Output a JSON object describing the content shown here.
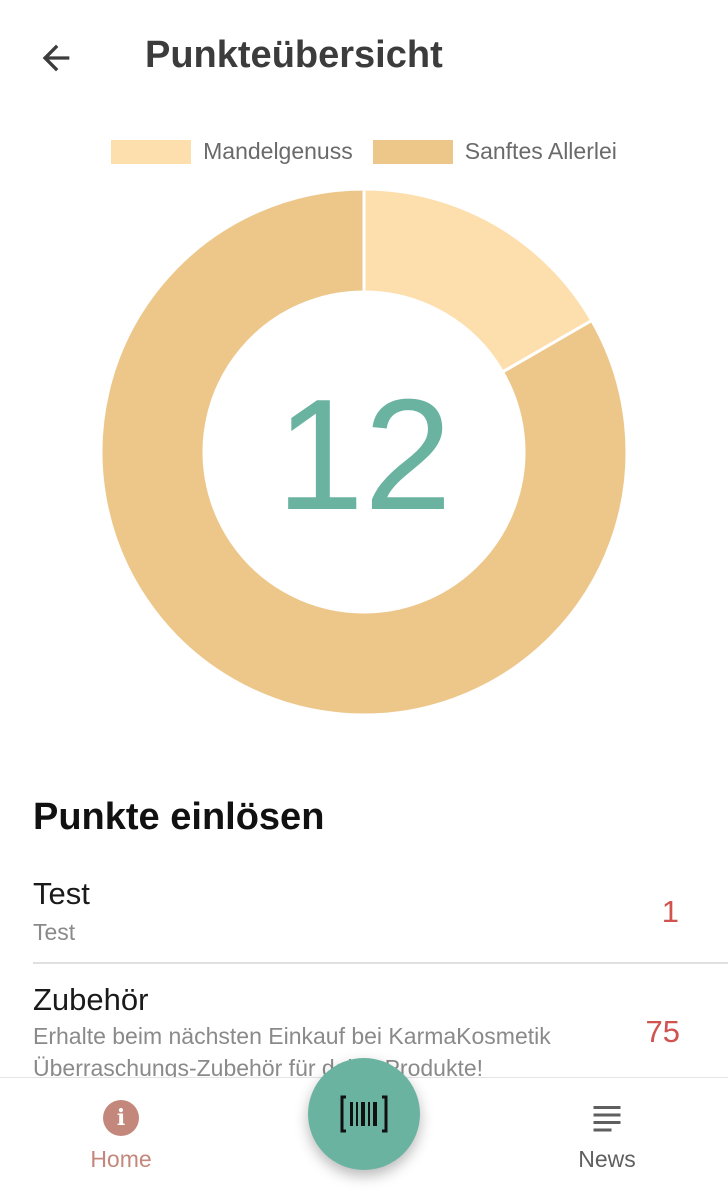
{
  "header": {
    "title": "Punkteübersicht",
    "back_icon": "arrow-left-icon"
  },
  "colors": {
    "accent": "#6bb3a1",
    "home_active": "#c4877c",
    "points_red": "#d0534f",
    "slice_light": "#fddfae",
    "slice_dark": "#edc78a"
  },
  "chart_data": {
    "type": "pie",
    "donut": true,
    "center_text": "12",
    "legend_position": "top",
    "series": [
      {
        "name": "Mandelgenuss",
        "value": 2,
        "color": "#fddfae"
      },
      {
        "name": "Sanftes Allerlei",
        "value": 10,
        "color": "#edc78a"
      }
    ]
  },
  "rewards": {
    "section_title": "Punkte einlösen",
    "items": [
      {
        "title": "Test",
        "description": "Test",
        "points": "1"
      },
      {
        "title": "Zubehör",
        "description": "Erhalte beim nächsten Einkauf bei KarmaKosmetik Überraschungs-Zubehör für deine Produkte!",
        "points": "75"
      }
    ]
  },
  "bottom_nav": {
    "home_label": "Home",
    "home_icon": "info-icon",
    "home_icon_glyph": "i",
    "news_label": "News",
    "news_icon": "news-icon",
    "scan_icon": "barcode-scan-icon"
  }
}
